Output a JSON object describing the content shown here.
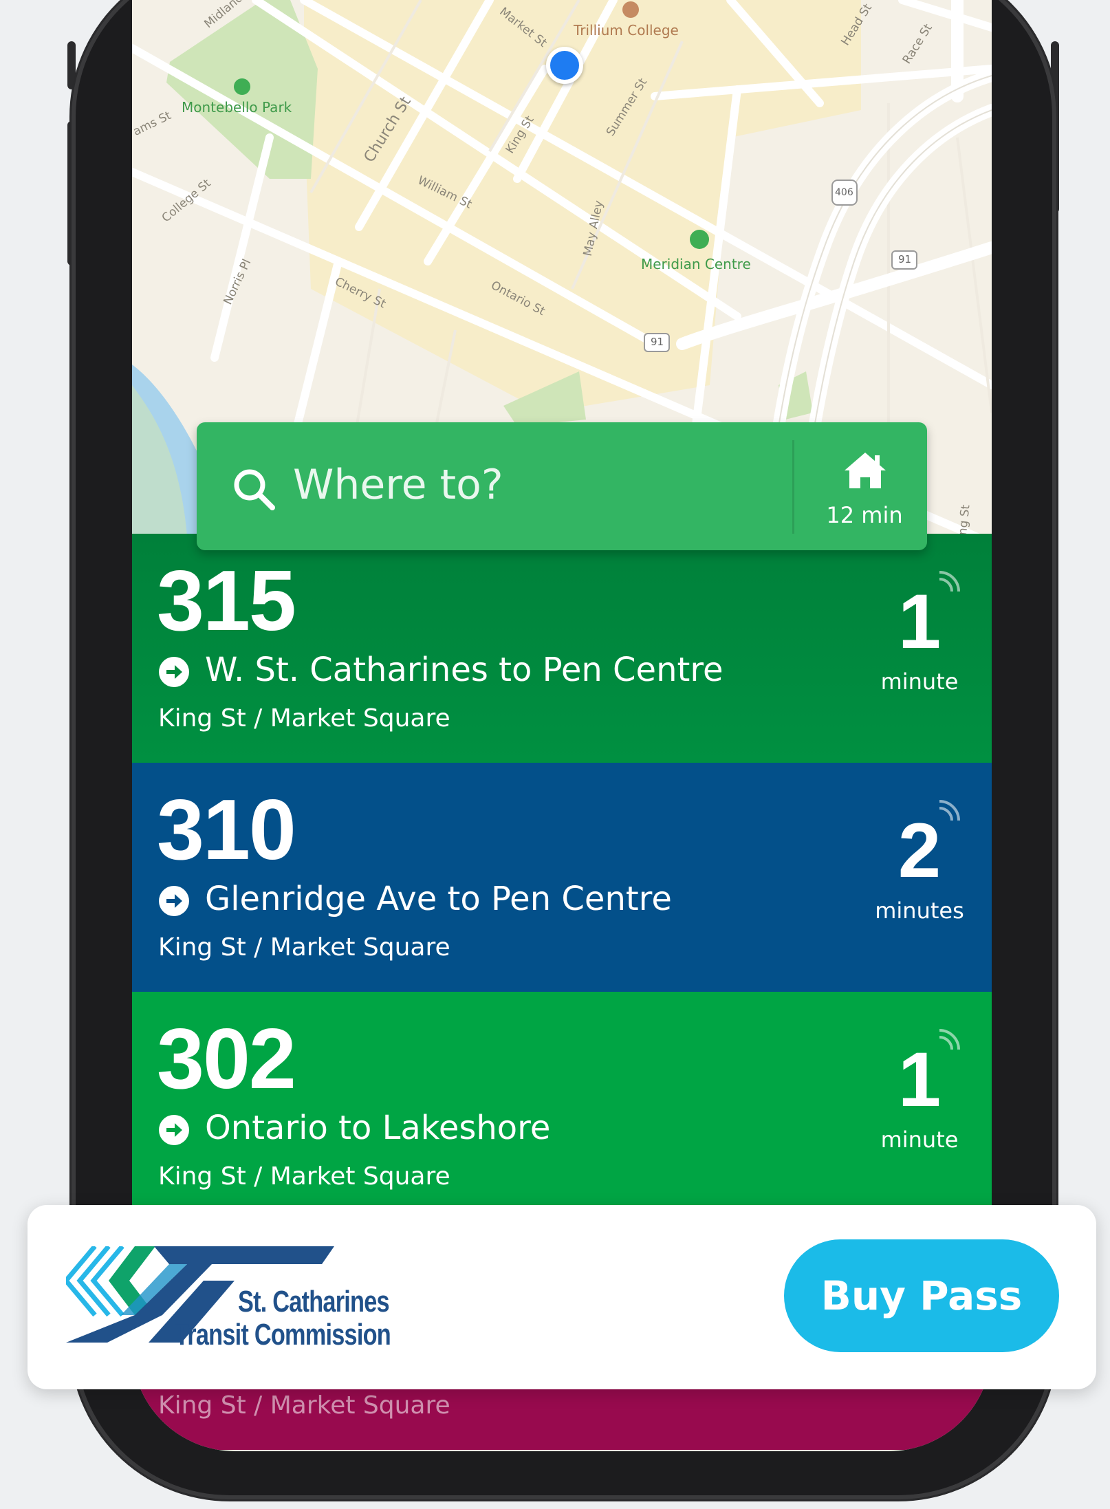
{
  "map": {
    "streets": [
      "Market St",
      "Church St",
      "King St",
      "Summer St",
      "William St",
      "College St",
      "Norris Pl",
      "Cherry St",
      "Ontario St",
      "May Alley",
      "Race St",
      "Head St",
      "Midland",
      "ams St",
      "ng St"
    ],
    "pois": {
      "college": "Trillium College",
      "park": "Montebello Park",
      "centre": "Meridian Centre"
    },
    "shields": [
      "91",
      "91",
      "406"
    ]
  },
  "search": {
    "placeholder": "Where to?",
    "home_time": "12 min"
  },
  "routes": [
    {
      "number": "315",
      "name": "W. St. Catharines to Pen Centre",
      "stop": "King St / Market Square",
      "eta": "1",
      "eta_unit": "minute",
      "color": "#008a3c"
    },
    {
      "number": "310",
      "name": "Glenridge Ave to Pen Centre",
      "stop": "King St / Market Square",
      "eta": "2",
      "eta_unit": "minutes",
      "color": "#03508a"
    },
    {
      "number": "302",
      "name": "Ontario to Lakeshore",
      "stop": "King St / Market Square",
      "eta": "1",
      "eta_unit": "minute",
      "color": "#00a544"
    },
    {
      "stop": "King St / Market Square",
      "color": "#980a4e"
    }
  ],
  "brand": {
    "line1": "St. Catharines",
    "line2": "Transit Commission",
    "colors": {
      "navy": "#21518a",
      "green": "#0fa36a",
      "light_blue": "#27b7e8"
    }
  },
  "buy_pass_label": "Buy Pass"
}
